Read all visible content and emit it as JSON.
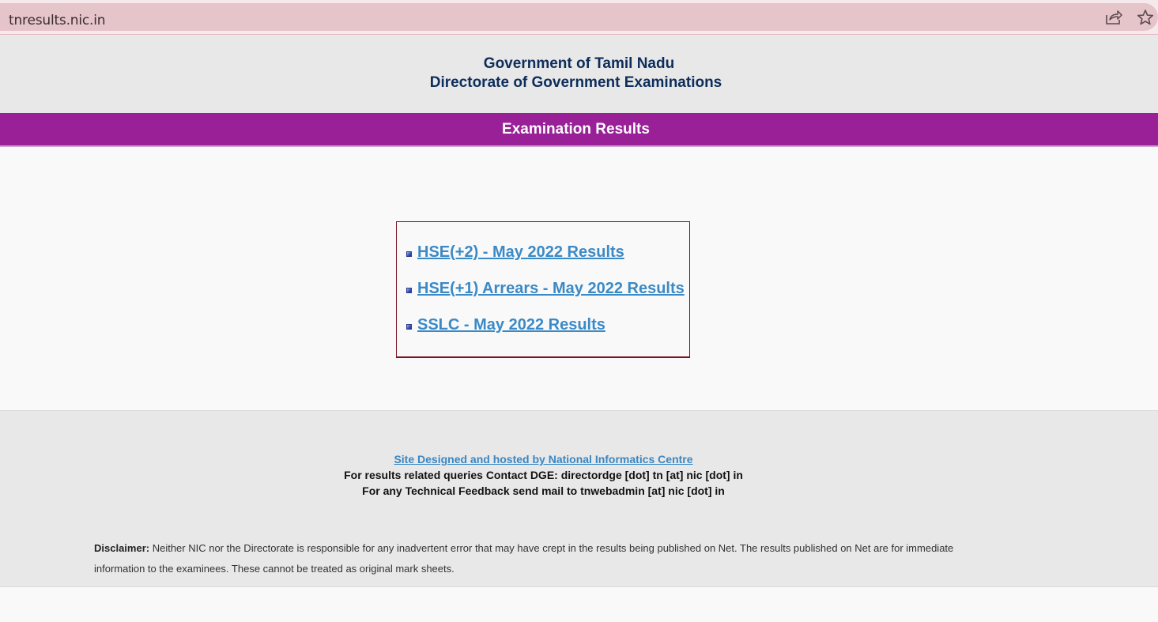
{
  "browser": {
    "url": "tnresults.nic.in"
  },
  "header": {
    "line1": "Government of Tamil Nadu",
    "line2": "Directorate of Government Examinations"
  },
  "banner": {
    "title": "Examination Results"
  },
  "results": {
    "items": [
      {
        "label": "HSE(+2) - May 2022 Results"
      },
      {
        "label": "HSE(+1) Arrears - May 2022 Results"
      },
      {
        "label": "SSLC - May 2022 Results"
      }
    ]
  },
  "footer": {
    "credit": "Site Designed and hosted by National Informatics Centre",
    "contact": "For results related queries Contact DGE:  directordge [dot] tn [at] nic [dot] in",
    "feedback": "For any Technical Feedback send mail to tnwebadmin [at] nic [dot] in",
    "disclaimer_label": "Disclaimer:",
    "disclaimer_text": " Neither NIC nor the Directorate is responsible for any inadvertent error that may have crept in the results being published on Net. The results published on Net are for immediate information to the examinees. These cannot be treated as original mark sheets."
  },
  "colors": {
    "banner": "#992097",
    "link": "#3b8ac6",
    "header_text": "#0d2d5a",
    "box_border": "#7a1020"
  },
  "icons": {
    "share": "share-icon",
    "star": "star-icon",
    "bullet": "square-bullet-icon"
  }
}
